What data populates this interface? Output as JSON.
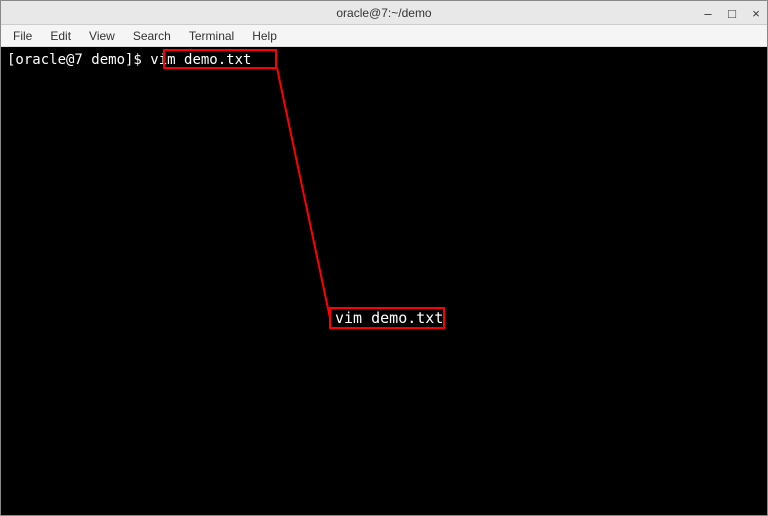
{
  "window": {
    "title": "oracle@7:~/demo"
  },
  "menubar": {
    "items": [
      "File",
      "Edit",
      "View",
      "Search",
      "Terminal",
      "Help"
    ]
  },
  "terminal": {
    "prompt": "[oracle@7 demo]$ ",
    "command": "vim demo.txt"
  },
  "annotation": {
    "callout_text": "vim demo.txt"
  }
}
